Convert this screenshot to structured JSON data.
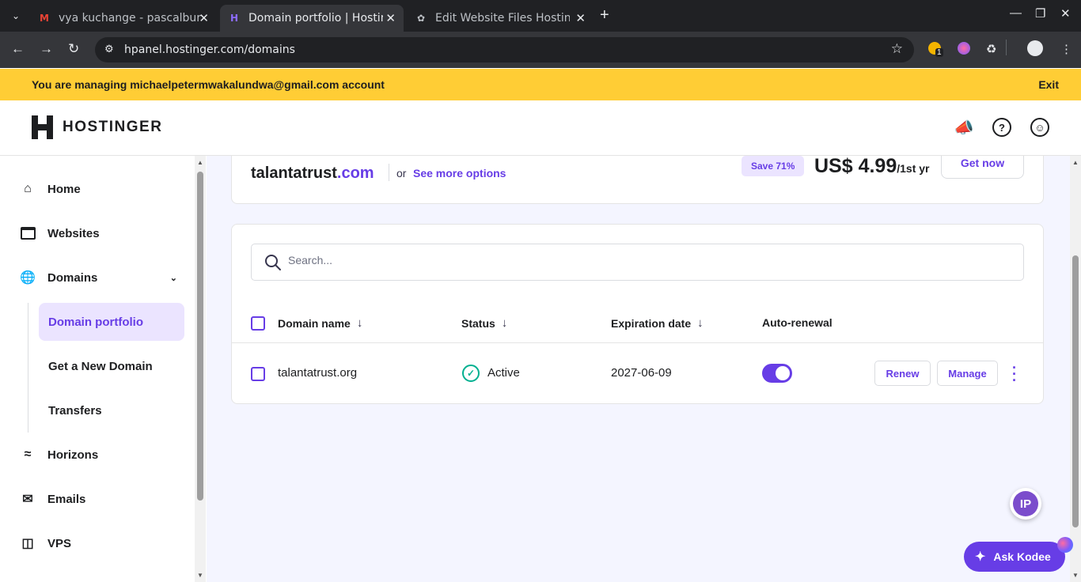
{
  "browser": {
    "tabs": [
      {
        "title": "vya kuchange - pascalbur",
        "icon": "gmail-icon",
        "active": false
      },
      {
        "title": "Domain portfolio | Hostin",
        "icon": "hostinger-icon",
        "active": true
      },
      {
        "title": "Edit Website Files Hostin",
        "icon": "openai-icon",
        "active": false
      }
    ],
    "url": "hpanel.hostinger.com/domains",
    "extension_badge": "1"
  },
  "banner": {
    "message": "You are managing michaelpetermwakalundwa@gmail.com account",
    "exit_label": "Exit"
  },
  "header": {
    "logo_text": "HOSTINGER",
    "icons": [
      "megaphone-icon",
      "help-icon",
      "account-icon"
    ]
  },
  "sidebar": {
    "items": [
      {
        "label": "Home",
        "icon": "home-icon"
      },
      {
        "label": "Websites",
        "icon": "browser-window-icon"
      },
      {
        "label": "Domains",
        "icon": "globe-icon",
        "expanded": true
      },
      {
        "label": "Horizons",
        "icon": "waves-icon"
      },
      {
        "label": "Emails",
        "icon": "mail-icon"
      },
      {
        "label": "VPS",
        "icon": "database-icon"
      }
    ],
    "domains_sub": [
      {
        "label": "Domain portfolio",
        "active": true
      },
      {
        "label": "Get a New Domain",
        "active": false
      },
      {
        "label": "Transfers",
        "active": false
      }
    ]
  },
  "promo": {
    "domain_name": "talantatrust",
    "domain_tld": ".com",
    "or_text": "or",
    "more_options": "See more options",
    "save_badge": "Save 71%",
    "price": "US$ 4.99",
    "price_period": "/1st yr",
    "cta": "Get now"
  },
  "portfolio": {
    "search_placeholder": "Search...",
    "columns": [
      "Domain name",
      "Status",
      "Expiration date",
      "Auto-renewal"
    ],
    "rows": [
      {
        "domain": "talantatrust.org",
        "status": "Active",
        "expiration": "2027-06-09",
        "auto_renewal": true
      }
    ],
    "renew_label": "Renew",
    "manage_label": "Manage"
  },
  "assistant": {
    "label": "Ask Kodee",
    "ip_badge": "IP"
  },
  "colors": {
    "accent": "#673de6",
    "banner": "#ffcd35",
    "active_status": "#00b090"
  }
}
